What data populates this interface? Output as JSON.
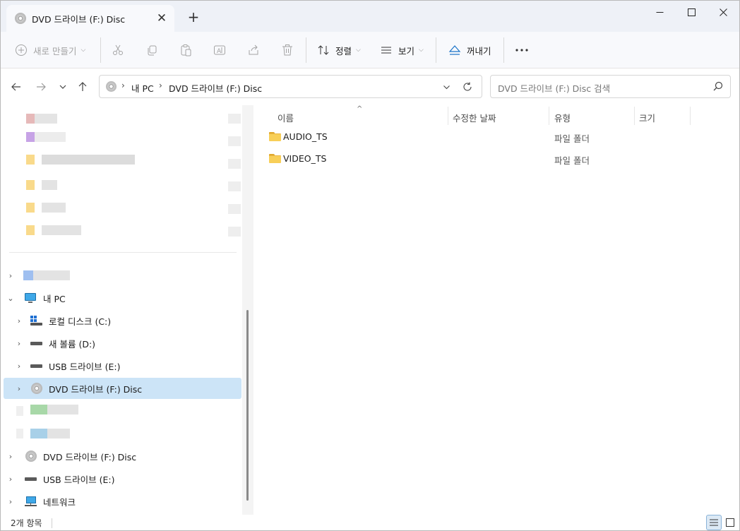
{
  "tab": {
    "title": "DVD 드라이브 (F:) Disc"
  },
  "toolbar": {
    "new_label": "새로 만들기",
    "sort_label": "정렬",
    "view_label": "보기",
    "eject_label": "꺼내기"
  },
  "address": {
    "crumbs": [
      "내 PC",
      "DVD 드라이브 (F:) Disc"
    ]
  },
  "search": {
    "placeholder": "DVD 드라이브 (F:) Disc 검색"
  },
  "nav": {
    "items": [
      {
        "label": "내 PC"
      },
      {
        "label": "로컬 디스크 (C:)"
      },
      {
        "label": "새 볼륨 (D:)"
      },
      {
        "label": "USB 드라이브 (E:)"
      },
      {
        "label": "DVD 드라이브 (F:) Disc"
      },
      {
        "label": "DVD 드라이브 (F:) Disc"
      },
      {
        "label": "USB 드라이브 (E:)"
      },
      {
        "label": "네트워크"
      }
    ]
  },
  "columns": [
    "이름",
    "수정한 날짜",
    "유형",
    "크기"
  ],
  "files": [
    {
      "name": "AUDIO_TS",
      "type": "파일 폴더"
    },
    {
      "name": "VIDEO_TS",
      "type": "파일 폴더"
    }
  ],
  "status": {
    "count": "2개 항목"
  },
  "colors": {
    "selected": "#cce4f7",
    "folder": "#f8cf58",
    "titlebar": "#eef1f7"
  }
}
